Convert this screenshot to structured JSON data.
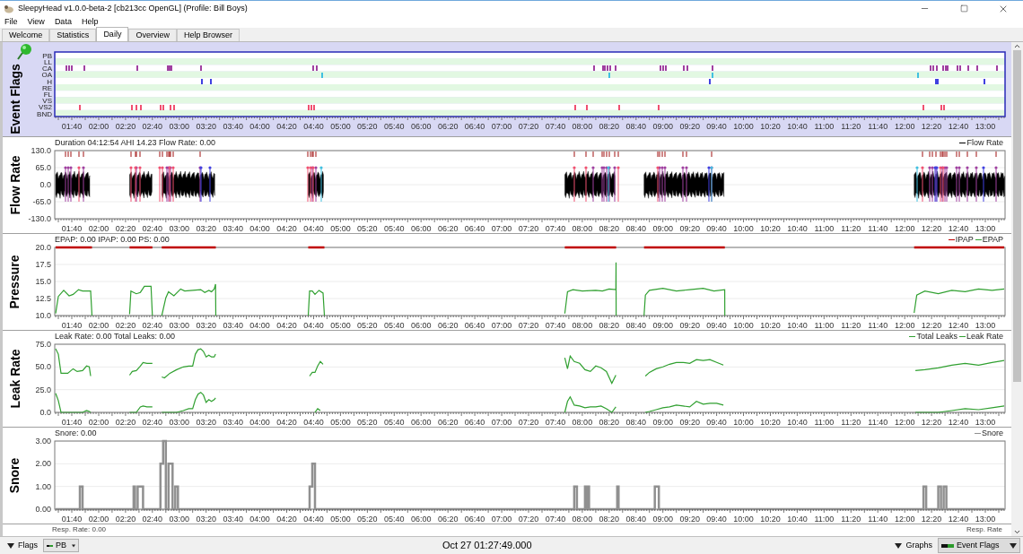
{
  "window": {
    "title": "SleepyHead v1.0.0-beta-2 [cb213cc OpenGL] (Profile: Bill Boys)"
  },
  "menu": [
    "File",
    "View",
    "Data",
    "Help"
  ],
  "tabs": [
    {
      "label": "Welcome",
      "selected": false
    },
    {
      "label": "Statistics",
      "selected": false
    },
    {
      "label": "Daily",
      "selected": true
    },
    {
      "label": "Overview",
      "selected": false
    },
    {
      "label": "Help Browser",
      "selected": false
    }
  ],
  "event_flags": {
    "title": "Event Flags",
    "rows": [
      {
        "label": "PB"
      },
      {
        "label": "LL"
      },
      {
        "label": "CA",
        "color": "#a040a0"
      },
      {
        "label": "OA",
        "color": "#40c0e0"
      },
      {
        "label": "H",
        "color": "#4040e0"
      },
      {
        "label": "RE"
      },
      {
        "label": "FL"
      },
      {
        "label": "VS"
      },
      {
        "label": "VS2",
        "color": "#f05070"
      },
      {
        "label": "BND"
      }
    ],
    "time_labels": [
      "01:40",
      "02:00",
      "02:20",
      "02:40",
      "03:00",
      "03:20",
      "03:40",
      "04:00",
      "04:20",
      "04:40",
      "05:00",
      "05:20",
      "05:40",
      "06:00",
      "06:20",
      "06:40",
      "07:00",
      "07:20",
      "07:40",
      "08:00",
      "08:20",
      "08:40",
      "09:00",
      "09:20",
      "09:40",
      "10:00",
      "10:20",
      "10:40",
      "11:00",
      "11:20",
      "11:40",
      "12:00",
      "12:20",
      "12:40",
      "13:00"
    ]
  },
  "flow_rate": {
    "title": "Flow Rate",
    "header": "Duration 04:12:54 AHI 14.23 Flow Rate: 0.00",
    "legend": "Flow Rate",
    "y_labels": [
      "130.0",
      "65.0",
      "0.0",
      "-65.0",
      "-130.0"
    ],
    "time_labels": [
      "01:40",
      "02:00",
      "02:20",
      "02:40",
      "03:00",
      "03:20",
      "03:40",
      "04:00",
      "04:20",
      "04:40",
      "05:00",
      "05:20",
      "05:40",
      "06:00",
      "06:20",
      "06:40",
      "07:00",
      "07:20",
      "07:40",
      "08:00",
      "08:20",
      "08:40",
      "09:00",
      "09:20",
      "09:40",
      "10:00",
      "10:20",
      "10:40",
      "11:00",
      "11:20",
      "11:40",
      "12:00",
      "12:20",
      "12:40",
      "13:00"
    ]
  },
  "pressure": {
    "header": "EPAP: 0.00 IPAP: 0.00 PS: 0.00",
    "chart_data": {
      "type": "line",
      "ylabel": "Pressure",
      "grid": true,
      "legend": true,
      "xlim": [
        87.3,
        794.7
      ],
      "ylim": [
        10,
        20
      ],
      "x": [
        88,
        90,
        94,
        98,
        101,
        105,
        108,
        114,
        115,
        116,
        143,
        144,
        148,
        151,
        154,
        159,
        160,
        163,
        167,
        170,
        172,
        176,
        181,
        184,
        190,
        196,
        199,
        202,
        204,
        206,
        207,
        207.2,
        240,
        276,
        277,
        279,
        281,
        284,
        287,
        288,
        400,
        467,
        469,
        473,
        480,
        490,
        495,
        500,
        505,
        505.1,
        505.2,
        515,
        526,
        527,
        530,
        540,
        550,
        560,
        570,
        578,
        586,
        586.1,
        650,
        727,
        729,
        735,
        745,
        755,
        765,
        775,
        785,
        794
      ],
      "series": [
        {
          "name": "IPAP",
          "color": "#c00000",
          "values": [
            20,
            20,
            20,
            20,
            20,
            20,
            20,
            20,
            20,
            null,
            20,
            20,
            20,
            20,
            20,
            20,
            20,
            null,
            20,
            20,
            20,
            20,
            20,
            20,
            20,
            20,
            20,
            20,
            20,
            20,
            20,
            20,
            null,
            20,
            20,
            20,
            20,
            20,
            20,
            20,
            null,
            20,
            20,
            20,
            20,
            20,
            20,
            20,
            20,
            20,
            20,
            null,
            20,
            20,
            20,
            20,
            20,
            20,
            20,
            20,
            20,
            20,
            null,
            20,
            20,
            20,
            20,
            20,
            20,
            20,
            20,
            20
          ]
        },
        {
          "name": "EPAP",
          "color": "#30a030",
          "values": [
            10.3,
            12.8,
            13.7,
            12.9,
            13.1,
            13.8,
            13.6,
            13.6,
            10,
            null,
            10.2,
            13.6,
            13.2,
            13.4,
            14.3,
            14.3,
            10,
            null,
            10,
            12.6,
            13.5,
            12.9,
            13.9,
            13.6,
            13.7,
            13.8,
            13.4,
            13.7,
            13.5,
            13.9,
            14.6,
            10,
            null,
            10,
            13.6,
            13.6,
            13.1,
            13.7,
            13.3,
            10,
            null,
            10.3,
            13.5,
            13.8,
            13.6,
            13.7,
            13.6,
            13.9,
            13.8,
            17.8,
            10,
            null,
            10,
            13,
            13.7,
            14,
            13.6,
            13.8,
            14,
            13.6,
            13.8,
            10,
            null,
            10.4,
            13,
            13.6,
            13.2,
            13.7,
            13.5,
            13.9,
            13.7,
            13.9
          ]
        }
      ],
      "xticks": [
        {
          "value": 100,
          "label": "01:40"
        },
        {
          "value": 120,
          "label": "02:00"
        },
        {
          "value": 140,
          "label": "02:20"
        },
        {
          "value": 160,
          "label": "02:40"
        },
        {
          "value": 180,
          "label": "03:00"
        },
        {
          "value": 200,
          "label": "03:20"
        },
        {
          "value": 220,
          "label": "03:40"
        },
        {
          "value": 240,
          "label": "04:00"
        },
        {
          "value": 260,
          "label": "04:20"
        },
        {
          "value": 280,
          "label": "04:40"
        },
        {
          "value": 300,
          "label": "05:00"
        },
        {
          "value": 320,
          "label": "05:20"
        },
        {
          "value": 340,
          "label": "05:40"
        },
        {
          "value": 360,
          "label": "06:00"
        },
        {
          "value": 380,
          "label": "06:20"
        },
        {
          "value": 400,
          "label": "06:40"
        },
        {
          "value": 420,
          "label": "07:00"
        },
        {
          "value": 440,
          "label": "07:20"
        },
        {
          "value": 460,
          "label": "07:40"
        },
        {
          "value": 480,
          "label": "08:00"
        },
        {
          "value": 500,
          "label": "08:20"
        },
        {
          "value": 520,
          "label": "08:40"
        },
        {
          "value": 540,
          "label": "09:00"
        },
        {
          "value": 560,
          "label": "09:20"
        },
        {
          "value": 580,
          "label": "09:40"
        },
        {
          "value": 600,
          "label": "10:00"
        },
        {
          "value": 620,
          "label": "10:20"
        },
        {
          "value": 640,
          "label": "10:40"
        },
        {
          "value": 660,
          "label": "11:00"
        },
        {
          "value": 680,
          "label": "11:20"
        },
        {
          "value": 700,
          "label": "11:40"
        },
        {
          "value": 720,
          "label": "12:00"
        },
        {
          "value": 740,
          "label": "12:20"
        },
        {
          "value": 760,
          "label": "12:40"
        },
        {
          "value": 780,
          "label": "13:00"
        }
      ],
      "yticks": [
        {
          "value": 10,
          "label": "10.0"
        },
        {
          "value": 12.5,
          "label": "12.5"
        },
        {
          "value": 15,
          "label": "15.0"
        },
        {
          "value": 17.5,
          "label": "17.5"
        },
        {
          "value": 20,
          "label": "20.0"
        }
      ]
    }
  },
  "leak_rate": {
    "header": "Leak Rate: 0.00 Total Leaks: 0.00",
    "chart_data": {
      "type": "line",
      "ylabel": "Leak Rate",
      "grid": true,
      "legend": true,
      "xlim": [
        87.3,
        794.7
      ],
      "ylim": [
        0,
        75
      ],
      "x": [
        88,
        90,
        92,
        97,
        101,
        104,
        108,
        111,
        113,
        114,
        116,
        143,
        145,
        148,
        151,
        153,
        156,
        160,
        163,
        167,
        169,
        173,
        178,
        183,
        187,
        190,
        192,
        194,
        196,
        198,
        200,
        202,
        204,
        206,
        207,
        240,
        277,
        279,
        281,
        283,
        285,
        287,
        400,
        467,
        469,
        471,
        474,
        478,
        482,
        486,
        490,
        494,
        498,
        502,
        505,
        515,
        527,
        530,
        535,
        540,
        545,
        550,
        555,
        560,
        565,
        570,
        575,
        580,
        585,
        650,
        728,
        735,
        745,
        755,
        765,
        775,
        785,
        794
      ],
      "series": [
        {
          "name": "Total Leaks",
          "color": "#30a030",
          "values": [
            70,
            64,
            43,
            43,
            48,
            45,
            46,
            51,
            50,
            40,
            null,
            41,
            45,
            46,
            51,
            55,
            54,
            54,
            null,
            39,
            38,
            43,
            47,
            50,
            51,
            51,
            64,
            69,
            70,
            67,
            61,
            63,
            61,
            61,
            64,
            null,
            40,
            44,
            44,
            51,
            56,
            53,
            null,
            60,
            48,
            62,
            56,
            54,
            47,
            45,
            51,
            49,
            45,
            32,
            41,
            null,
            40,
            44,
            48,
            50,
            53,
            55,
            55,
            54,
            58,
            57,
            58,
            55,
            52,
            null,
            46,
            47,
            49,
            52,
            54,
            52,
            55,
            57
          ]
        },
        {
          "name": "Leak Rate",
          "color": "#30a030",
          "values": [
            21,
            13,
            0,
            0,
            0,
            0,
            0,
            2,
            1,
            0,
            null,
            0,
            0,
            0,
            6,
            7,
            6,
            6,
            null,
            0,
            0,
            0,
            0,
            2,
            4,
            4,
            14,
            20,
            22,
            19,
            11,
            14,
            12,
            14,
            16,
            null,
            null,
            null,
            0,
            4,
            2,
            null,
            null,
            0,
            12,
            17,
            8,
            7,
            5,
            6,
            6,
            7,
            4,
            0,
            6,
            null,
            0,
            1,
            3,
            5,
            6,
            8,
            7,
            6,
            12,
            9,
            10,
            10,
            8,
            null,
            0,
            0,
            0,
            2,
            4,
            3,
            5,
            7
          ]
        }
      ],
      "xticks": [
        {
          "value": 100,
          "label": "01:40"
        },
        {
          "value": 120,
          "label": "02:00"
        },
        {
          "value": 140,
          "label": "02:20"
        },
        {
          "value": 160,
          "label": "02:40"
        },
        {
          "value": 180,
          "label": "03:00"
        },
        {
          "value": 200,
          "label": "03:20"
        },
        {
          "value": 220,
          "label": "03:40"
        },
        {
          "value": 240,
          "label": "04:00"
        },
        {
          "value": 260,
          "label": "04:20"
        },
        {
          "value": 280,
          "label": "04:40"
        },
        {
          "value": 300,
          "label": "05:00"
        },
        {
          "value": 320,
          "label": "05:20"
        },
        {
          "value": 340,
          "label": "05:40"
        },
        {
          "value": 360,
          "label": "06:00"
        },
        {
          "value": 380,
          "label": "06:20"
        },
        {
          "value": 400,
          "label": "06:40"
        },
        {
          "value": 420,
          "label": "07:00"
        },
        {
          "value": 440,
          "label": "07:20"
        },
        {
          "value": 460,
          "label": "07:40"
        },
        {
          "value": 480,
          "label": "08:00"
        },
        {
          "value": 500,
          "label": "08:20"
        },
        {
          "value": 520,
          "label": "08:40"
        },
        {
          "value": 540,
          "label": "09:00"
        },
        {
          "value": 560,
          "label": "09:20"
        },
        {
          "value": 580,
          "label": "09:40"
        },
        {
          "value": 600,
          "label": "10:00"
        },
        {
          "value": 620,
          "label": "10:20"
        },
        {
          "value": 640,
          "label": "10:40"
        },
        {
          "value": 660,
          "label": "11:00"
        },
        {
          "value": 680,
          "label": "11:20"
        },
        {
          "value": 700,
          "label": "11:40"
        },
        {
          "value": 720,
          "label": "12:00"
        },
        {
          "value": 740,
          "label": "12:20"
        },
        {
          "value": 760,
          "label": "12:40"
        },
        {
          "value": 780,
          "label": "13:00"
        }
      ],
      "yticks": [
        {
          "value": 0,
          "label": "0.0"
        },
        {
          "value": 25,
          "label": "25.0"
        },
        {
          "value": 50,
          "label": "50.0"
        },
        {
          "value": 75,
          "label": "75.0"
        }
      ]
    }
  },
  "snore": {
    "header": "Snore: 0.00",
    "chart_data": {
      "type": "line",
      "ylabel": "Snore",
      "grid": true,
      "legend": true,
      "xlim": [
        87.3,
        794.7
      ],
      "ylim": [
        0,
        3
      ],
      "x": [
        88,
        106,
        106,
        108,
        108,
        146,
        146,
        147,
        147,
        149,
        149,
        153,
        153,
        166,
        166,
        168,
        168,
        170,
        170,
        172,
        172,
        175,
        175,
        177,
        177,
        179,
        179,
        277,
        277,
        279,
        279,
        281,
        281,
        474,
        474,
        476,
        476,
        482,
        482,
        483,
        483,
        484,
        484,
        485,
        485,
        506,
        506,
        507,
        507,
        534,
        534,
        537,
        537,
        734,
        734,
        736,
        736,
        745,
        745,
        747,
        747,
        749,
        749,
        751,
        751,
        794
      ],
      "series": [
        {
          "name": "Snore",
          "color": "#909090",
          "values": [
            0,
            0,
            1,
            1,
            0,
            0,
            1,
            1,
            0,
            0,
            1,
            1,
            0,
            0,
            2,
            2,
            3,
            3,
            0,
            0,
            2,
            2,
            0,
            0,
            1,
            1,
            0,
            0,
            1,
            1,
            2,
            2,
            0,
            0,
            1,
            1,
            0,
            0,
            1,
            1,
            0,
            0,
            1,
            1,
            0,
            0,
            1,
            1,
            0,
            0,
            1,
            1,
            0,
            0,
            1,
            1,
            0,
            0,
            1,
            1,
            0,
            0,
            1,
            1,
            0,
            0
          ]
        }
      ],
      "xticks": [
        {
          "value": 100,
          "label": "01:40"
        },
        {
          "value": 120,
          "label": "02:00"
        },
        {
          "value": 140,
          "label": "02:20"
        },
        {
          "value": 160,
          "label": "02:40"
        },
        {
          "value": 180,
          "label": "03:00"
        },
        {
          "value": 200,
          "label": "03:20"
        },
        {
          "value": 220,
          "label": "03:40"
        },
        {
          "value": 240,
          "label": "04:00"
        },
        {
          "value": 260,
          "label": "04:20"
        },
        {
          "value": 280,
          "label": "04:40"
        },
        {
          "value": 300,
          "label": "05:00"
        },
        {
          "value": 320,
          "label": "05:20"
        },
        {
          "value": 340,
          "label": "05:40"
        },
        {
          "value": 360,
          "label": "06:00"
        },
        {
          "value": 380,
          "label": "06:20"
        },
        {
          "value": 400,
          "label": "06:40"
        },
        {
          "value": 420,
          "label": "07:00"
        },
        {
          "value": 440,
          "label": "07:20"
        },
        {
          "value": 460,
          "label": "07:40"
        },
        {
          "value": 480,
          "label": "08:00"
        },
        {
          "value": 500,
          "label": "08:20"
        },
        {
          "value": 520,
          "label": "08:40"
        },
        {
          "value": 540,
          "label": "09:00"
        },
        {
          "value": 560,
          "label": "09:20"
        },
        {
          "value": 580,
          "label": "09:40"
        },
        {
          "value": 600,
          "label": "10:00"
        },
        {
          "value": 620,
          "label": "10:20"
        },
        {
          "value": 640,
          "label": "10:40"
        },
        {
          "value": 660,
          "label": "11:00"
        },
        {
          "value": 680,
          "label": "11:20"
        },
        {
          "value": 700,
          "label": "11:40"
        },
        {
          "value": 720,
          "label": "12:00"
        },
        {
          "value": 740,
          "label": "12:20"
        },
        {
          "value": 760,
          "label": "12:40"
        },
        {
          "value": 780,
          "label": "13:00"
        }
      ],
      "yticks": [
        {
          "value": 0,
          "label": "0.00"
        },
        {
          "value": 1,
          "label": "1.00"
        },
        {
          "value": 2,
          "label": "2.00"
        },
        {
          "value": 3,
          "label": "3.00"
        }
      ]
    }
  },
  "resp_rate": {
    "header": "Resp. Rate: 0.00",
    "legend": "Resp. Rate"
  },
  "bottom_bar": {
    "flags_button": "Flags",
    "flags_dropdown": "PB",
    "datetime": "Oct 27 01:27:49.000",
    "graphs_button": "Graphs",
    "graphs_dropdown": "Event Flags"
  }
}
